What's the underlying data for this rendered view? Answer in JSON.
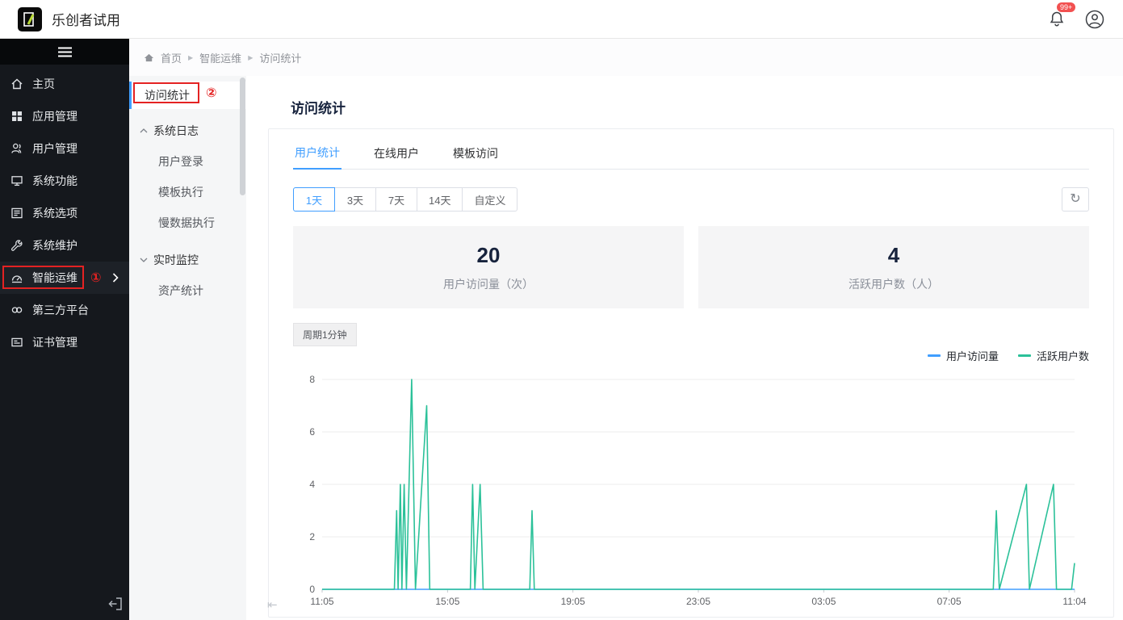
{
  "header": {
    "title": "乐创者试用",
    "badge": "99+"
  },
  "sidebar": {
    "items": [
      {
        "icon": "home-icon",
        "label": "主页"
      },
      {
        "icon": "apps-icon",
        "label": "应用管理"
      },
      {
        "icon": "users-icon",
        "label": "用户管理"
      },
      {
        "icon": "monitor-icon",
        "label": "系统功能"
      },
      {
        "icon": "options-icon",
        "label": "系统选项"
      },
      {
        "icon": "wrench-icon",
        "label": "系统维护"
      },
      {
        "icon": "ops-icon",
        "label": "智能运维"
      },
      {
        "icon": "link-icon",
        "label": "第三方平台"
      },
      {
        "icon": "certificate-icon",
        "label": "证书管理"
      }
    ]
  },
  "breadcrumb": [
    "首页",
    "智能运维",
    "访问统计"
  ],
  "submenu": {
    "selected": "访问统计",
    "groups": [
      {
        "label": "系统日志",
        "expanded": true,
        "children": [
          "用户登录",
          "模板执行",
          "慢数据执行"
        ]
      },
      {
        "label": "实时监控",
        "expanded": false,
        "children": [
          "资产统计"
        ]
      }
    ]
  },
  "annotations": {
    "one": "①",
    "two": "②",
    "color": "#e42222"
  },
  "main": {
    "title": "访问统计",
    "tabs": [
      {
        "label": "用户统计",
        "active": true
      },
      {
        "label": "在线用户",
        "active": false
      },
      {
        "label": "模板访问",
        "active": false
      }
    ],
    "ranges": [
      "1天",
      "3天",
      "7天",
      "14天",
      "自定义"
    ],
    "active_range": "1天",
    "stats": [
      {
        "value": "20",
        "label": "用户访问量（次）"
      },
      {
        "value": "4",
        "label": "活跃用户数（人）"
      }
    ],
    "period_label": "周期1分钟",
    "legend": [
      {
        "label": "用户访问量",
        "color": "#409eff"
      },
      {
        "label": "活跃用户数",
        "color": "#2bc199"
      }
    ]
  },
  "chart_data": {
    "type": "line",
    "title": "",
    "xlabel": "",
    "ylabel": "",
    "ylim": [
      0,
      8
    ],
    "yticks": [
      0,
      2,
      4,
      6,
      8
    ],
    "grid": true,
    "legend_position": "top-right",
    "xticks": [
      {
        "pos": 0.0,
        "label": "11:05"
      },
      {
        "pos": 0.1667,
        "label": "15:05"
      },
      {
        "pos": 0.3333,
        "label": "19:05"
      },
      {
        "pos": 0.5,
        "label": "23:05"
      },
      {
        "pos": 0.6667,
        "label": "03:05"
      },
      {
        "pos": 0.8333,
        "label": "07:05"
      },
      {
        "pos": 1.0,
        "label": "11:04"
      }
    ],
    "series": [
      {
        "name": "用户访问量",
        "color": "#409eff",
        "points": [
          [
            0,
            0
          ],
          [
            1,
            0
          ]
        ]
      },
      {
        "name": "活跃用户数",
        "color": "#2bc199",
        "points": [
          [
            0.0,
            0
          ],
          [
            0.096,
            0
          ],
          [
            0.099,
            3
          ],
          [
            0.101,
            0
          ],
          [
            0.104,
            4
          ],
          [
            0.106,
            0
          ],
          [
            0.109,
            4
          ],
          [
            0.112,
            0
          ],
          [
            0.119,
            8
          ],
          [
            0.124,
            0
          ],
          [
            0.139,
            7
          ],
          [
            0.143,
            0
          ],
          [
            0.197,
            0
          ],
          [
            0.2,
            4
          ],
          [
            0.203,
            0
          ],
          [
            0.21,
            4
          ],
          [
            0.214,
            0
          ],
          [
            0.276,
            0
          ],
          [
            0.279,
            3
          ],
          [
            0.282,
            0
          ],
          [
            0.892,
            0
          ],
          [
            0.896,
            3
          ],
          [
            0.9,
            0
          ],
          [
            0.936,
            4
          ],
          [
            0.94,
            0
          ],
          [
            0.972,
            4
          ],
          [
            0.976,
            0
          ],
          [
            0.996,
            0
          ],
          [
            1.0,
            1
          ]
        ]
      }
    ]
  }
}
